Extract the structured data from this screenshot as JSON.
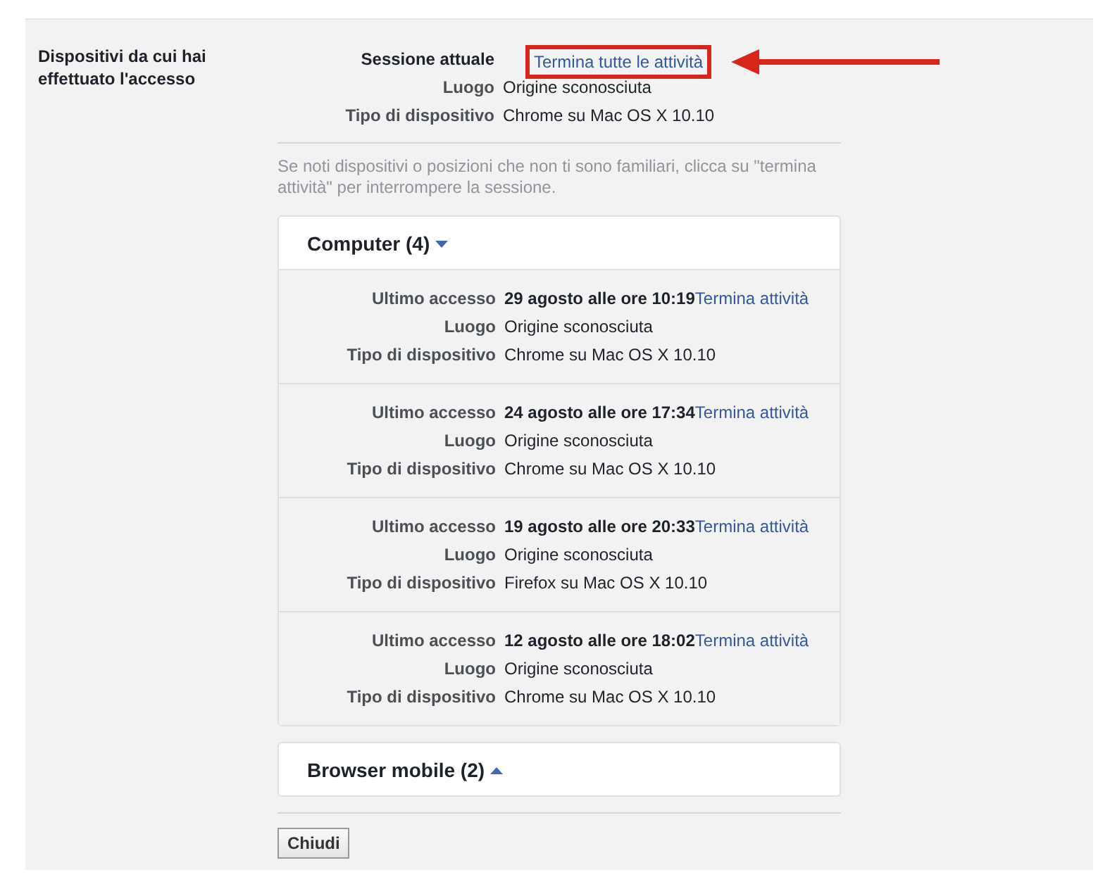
{
  "section_label": "Dispositivi da cui hai effettuato l'accesso",
  "current_session": {
    "rows": [
      {
        "label": "Sessione attuale",
        "value": "",
        "kind": "header"
      },
      {
        "label": "Luogo",
        "value": "Origine sconosciuta",
        "kind": "plain"
      },
      {
        "label": "Tipo di dispositivo",
        "value": "Chrome su Mac OS X 10.10",
        "kind": "plain"
      }
    ],
    "link": "Termina tutte le attività",
    "highlighted": true
  },
  "note": "Se noti dispositivi o posizioni che non ti sono familiari, clicca su \"termina attività\" per interrompere la sessione.",
  "groups": [
    {
      "title": "Computer (4)",
      "expanded": true,
      "sessions": [
        {
          "rows": [
            {
              "label": "Ultimo accesso",
              "value": "29 agosto alle ore 10:19"
            },
            {
              "label": "Luogo",
              "value": "Origine sconosciuta"
            },
            {
              "label": "Tipo di dispositivo",
              "value": "Chrome su Mac OS X 10.10"
            }
          ],
          "link": "Termina attività"
        },
        {
          "rows": [
            {
              "label": "Ultimo accesso",
              "value": "24 agosto alle ore 17:34"
            },
            {
              "label": "Luogo",
              "value": "Origine sconosciuta"
            },
            {
              "label": "Tipo di dispositivo",
              "value": "Chrome su Mac OS X 10.10"
            }
          ],
          "link": "Termina attività"
        },
        {
          "rows": [
            {
              "label": "Ultimo accesso",
              "value": "19 agosto alle ore 20:33"
            },
            {
              "label": "Luogo",
              "value": "Origine sconosciuta"
            },
            {
              "label": "Tipo di dispositivo",
              "value": "Firefox su Mac OS X 10.10"
            }
          ],
          "link": "Termina attività"
        },
        {
          "rows": [
            {
              "label": "Ultimo accesso",
              "value": "12 agosto alle ore 18:02"
            },
            {
              "label": "Luogo",
              "value": "Origine sconosciuta"
            },
            {
              "label": "Tipo di dispositivo",
              "value": "Chrome su Mac OS X 10.10"
            }
          ],
          "link": "Termina attività"
        }
      ]
    },
    {
      "title": "Browser mobile (2)",
      "expanded": false
    }
  ],
  "close_button": "Chiudi"
}
